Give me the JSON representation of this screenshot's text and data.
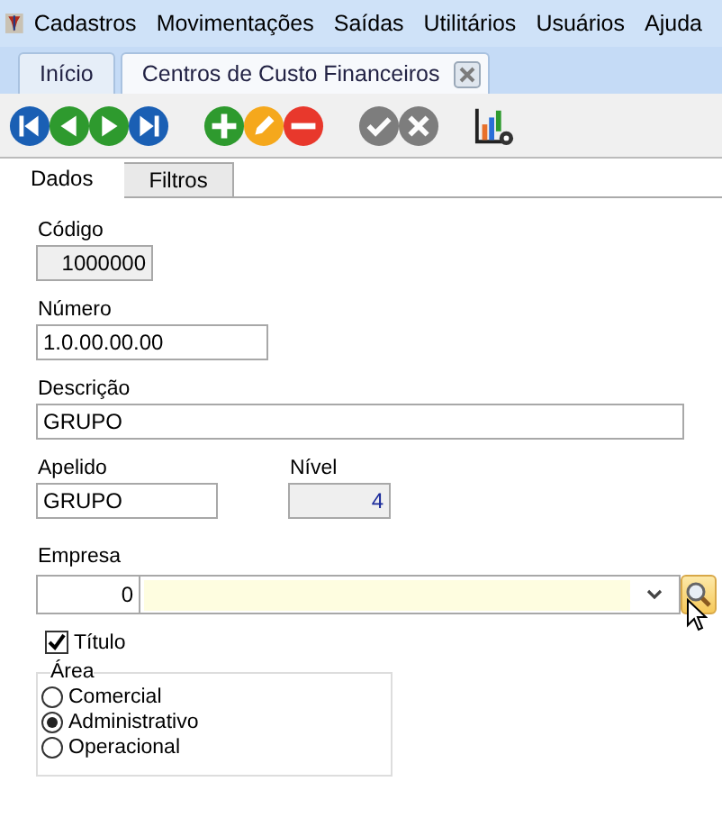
{
  "menu": [
    "Cadastros",
    "Movimentações",
    "Saídas",
    "Utilitários",
    "Usuários",
    "Ajuda"
  ],
  "tabs": [
    {
      "label": "Início",
      "selected": false,
      "closable": false
    },
    {
      "label": "Centros de Custo Financeiros",
      "selected": true,
      "closable": true
    }
  ],
  "toolbar": [
    {
      "kind": "first"
    },
    {
      "kind": "prev"
    },
    {
      "kind": "next"
    },
    {
      "kind": "last"
    },
    {
      "kind": "gap"
    },
    {
      "kind": "add"
    },
    {
      "kind": "edit"
    },
    {
      "kind": "delete"
    },
    {
      "kind": "gap"
    },
    {
      "kind": "confirm",
      "disabled": true
    },
    {
      "kind": "cancel",
      "disabled": true
    },
    {
      "kind": "gap"
    },
    {
      "kind": "report"
    }
  ],
  "subtabs": [
    {
      "label": "Dados",
      "selected": true
    },
    {
      "label": "Filtros",
      "selected": false
    }
  ],
  "form": {
    "codigo": {
      "label": "Código",
      "value": "1000000",
      "disabled": true
    },
    "numero": {
      "label": "Número",
      "value": "1.0.00.00.00",
      "disabled": false
    },
    "descricao": {
      "label": "Descrição",
      "value": "GRUPO",
      "disabled": false
    },
    "apelido": {
      "label": "Apelido",
      "value": "GRUPO",
      "disabled": false
    },
    "nivel": {
      "label": "Nível",
      "value": "4",
      "disabled": true
    },
    "empresa": {
      "label": "Empresa",
      "code": "0"
    },
    "titulo": {
      "label": "Título",
      "checked": true
    },
    "area": {
      "legend": "Área",
      "options": [
        {
          "label": "Comercial",
          "selected": false
        },
        {
          "label": "Administrativo",
          "selected": true
        },
        {
          "label": "Operacional",
          "selected": false
        }
      ]
    }
  }
}
